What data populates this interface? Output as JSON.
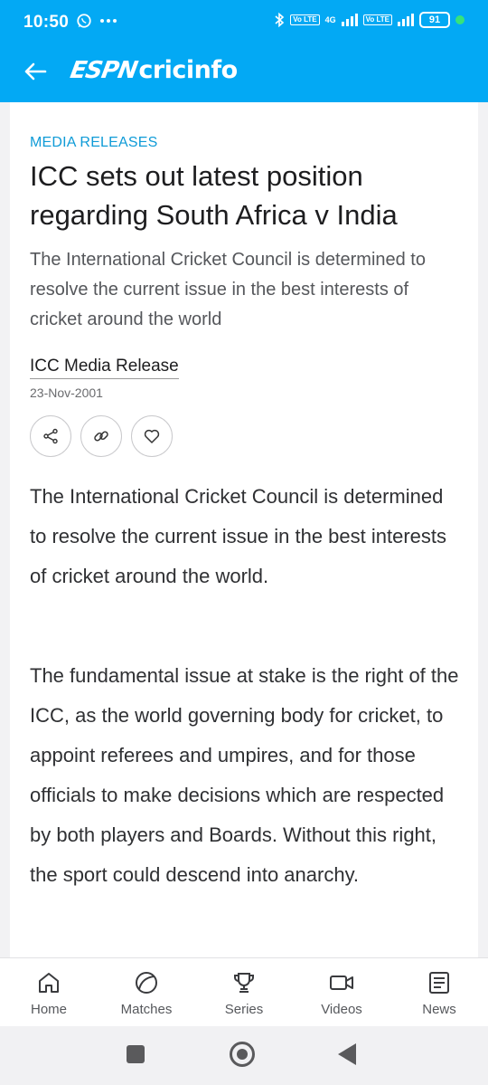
{
  "status_bar": {
    "time": "10:50",
    "left_icons": [
      "whatsapp-icon",
      "more-dots-icon"
    ],
    "sim1_tag": "Vo LTE",
    "network": "4G",
    "sim2_tag": "Vo LTE",
    "battery": "91",
    "colors": {
      "dot": "#37e37b"
    }
  },
  "app_bar": {
    "brand_espn": "ESPN",
    "brand_cricinfo": "cricinfo",
    "back_icon": "arrow-left-icon",
    "background": "#03a9f4"
  },
  "article": {
    "section": "MEDIA RELEASES",
    "title": "ICC sets out latest position regarding South Africa v India",
    "summary": "The International Cricket Council is determined to resolve the current issue in the best interests of cricket around the world",
    "author": "ICC Media Release",
    "date": "23-Nov-2001",
    "actions": [
      "share-icon",
      "link-icon",
      "heart-icon"
    ],
    "paragraphs": [
      "The International Cricket Council is determined to resolve the current issue in the best interests of cricket around the world.",
      "The fundamental issue at stake is the right of the ICC, as the world governing body for cricket, to appoint referees and umpires, and for those officials to make decisions which are respected by both players and Boards. Without this right, the sport could descend into anarchy."
    ]
  },
  "bottom_nav": {
    "items": [
      {
        "label": "Home",
        "icon": "home-icon"
      },
      {
        "label": "Matches",
        "icon": "ball-icon"
      },
      {
        "label": "Series",
        "icon": "trophy-icon"
      },
      {
        "label": "Videos",
        "icon": "video-icon"
      },
      {
        "label": "News",
        "icon": "news-icon"
      }
    ]
  },
  "system_nav": [
    "recents-button",
    "home-button",
    "back-button"
  ]
}
